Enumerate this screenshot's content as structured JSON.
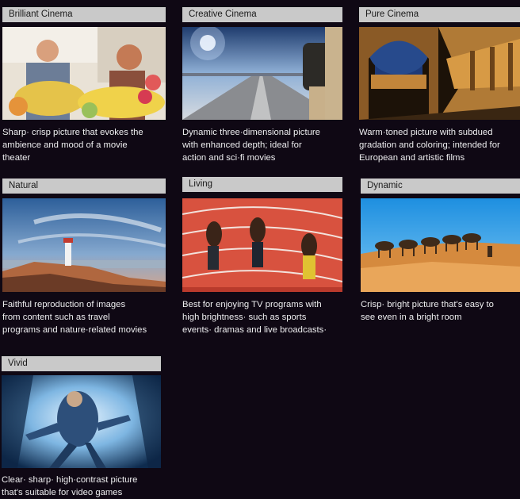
{
  "modes": [
    {
      "id": "brilliant-cinema",
      "label": "Brilliant Cinema",
      "image": "flower-shop-couple",
      "desc_lines": [
        "Sharp· crisp picture that evokes the",
        "ambience and mood of a movie",
        "theater"
      ]
    },
    {
      "id": "creative-cinema",
      "label": "Creative Cinema",
      "image": "road-backpack-figure",
      "desc_lines": [
        "Dynamic three·dimensional picture",
        "with enhanced depth; ideal for",
        "action and sci·fi movies"
      ]
    },
    {
      "id": "pure-cinema",
      "label": "Pure Cinema",
      "image": "arched-plaza-night",
      "desc_lines": [
        "Warm·toned picture with subdued",
        "gradation and coloring; intended for",
        "European and artistic films"
      ]
    },
    {
      "id": "natural",
      "label": "Natural",
      "image": "lighthouse-coast",
      "desc_lines": [
        "Faithful reproduction of images",
        "from content such as travel",
        "programs and nature·related movies"
      ]
    },
    {
      "id": "living",
      "label": "Living",
      "image": "sprinters-track",
      "desc_lines": [
        "Best for enjoying TV programs with",
        "high brightness· such as sports",
        "events· dramas and live broadcasts·"
      ]
    },
    {
      "id": "dynamic",
      "label": "Dynamic",
      "image": "camel-caravan-desert",
      "desc_lines": [
        "Crisp· bright picture that's easy to",
        "see even in a bright room"
      ]
    },
    {
      "id": "vivid",
      "label": "Vivid",
      "image": "superhero-action",
      "desc_lines": [
        "Clear· sharp· high·contrast picture",
        "that's suitable for video games"
      ]
    }
  ]
}
